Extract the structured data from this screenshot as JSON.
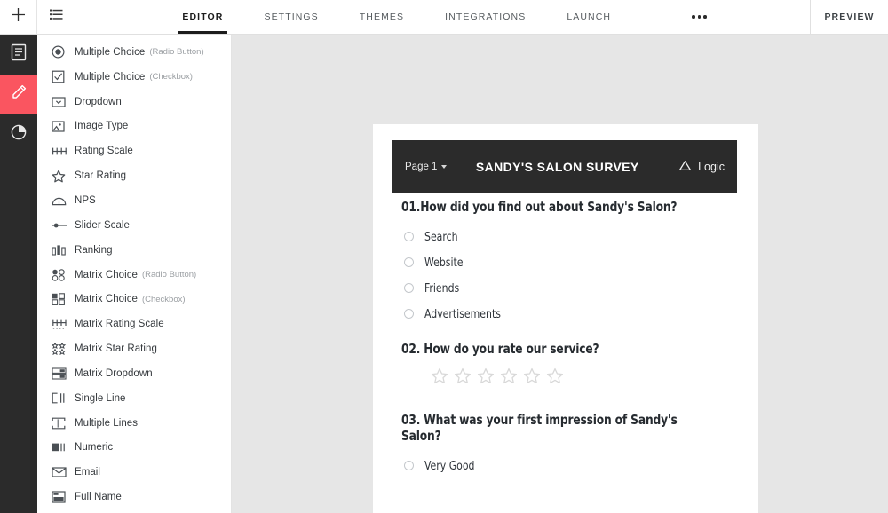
{
  "topbar": {
    "add_icon": "plus-icon",
    "list_icon": "bulleted-list-icon",
    "tabs": [
      {
        "label": "EDITOR",
        "active": true
      },
      {
        "label": "SETTINGS",
        "active": false
      },
      {
        "label": "THEMES",
        "active": false
      },
      {
        "label": "INTEGRATIONS",
        "active": false
      },
      {
        "label": "LAUNCH",
        "active": false
      }
    ],
    "more_icon": "ellipsis-icon",
    "preview_label": "PREVIEW"
  },
  "rail": {
    "items": [
      {
        "name": "pages-icon",
        "active": false
      },
      {
        "name": "edit-pencil-icon",
        "active": true
      },
      {
        "name": "analytics-pie-icon",
        "active": false
      }
    ],
    "active_color": "#fa5560",
    "background": "#2b2b2b"
  },
  "sidebar": {
    "items": [
      {
        "label": "Multiple Choice",
        "sub": "(Radio Button)",
        "icon": "radio-button-icon"
      },
      {
        "label": "Multiple Choice",
        "sub": "(Checkbox)",
        "icon": "checkbox-icon"
      },
      {
        "label": "Dropdown",
        "sub": "",
        "icon": "dropdown-icon"
      },
      {
        "label": "Image Type",
        "sub": "",
        "icon": "image-icon"
      },
      {
        "label": "Rating Scale",
        "sub": "",
        "icon": "rating-scale-icon"
      },
      {
        "label": "Star Rating",
        "sub": "",
        "icon": "star-icon"
      },
      {
        "label": "NPS",
        "sub": "",
        "icon": "gauge-icon"
      },
      {
        "label": "Slider Scale",
        "sub": "",
        "icon": "slider-icon"
      },
      {
        "label": "Ranking",
        "sub": "",
        "icon": "ranking-bars-icon"
      },
      {
        "label": "Matrix Choice",
        "sub": "(Radio Button)",
        "icon": "matrix-radio-icon"
      },
      {
        "label": "Matrix Choice",
        "sub": "(Checkbox)",
        "icon": "matrix-checkbox-icon"
      },
      {
        "label": "Matrix Rating Scale",
        "sub": "",
        "icon": "matrix-rating-icon"
      },
      {
        "label": "Matrix Star Rating",
        "sub": "",
        "icon": "matrix-star-icon"
      },
      {
        "label": "Matrix Dropdown",
        "sub": "",
        "icon": "matrix-dropdown-icon"
      },
      {
        "label": "Single Line",
        "sub": "",
        "icon": "single-line-icon"
      },
      {
        "label": "Multiple Lines",
        "sub": "",
        "icon": "multiple-lines-icon"
      },
      {
        "label": "Numeric",
        "sub": "",
        "icon": "numeric-icon"
      },
      {
        "label": "Email",
        "sub": "",
        "icon": "email-icon"
      },
      {
        "label": "Full Name",
        "sub": "",
        "icon": "full-name-icon"
      }
    ]
  },
  "survey": {
    "page_selector": "Page 1",
    "title": "SANDY'S SALON SURVEY",
    "logic_label": "Logic",
    "logic_icon": "logic-triangle-icon",
    "header_bg": "#2b2b2b",
    "questions": [
      {
        "title": "01.How did you find out about Sandy's Salon?",
        "type": "radio",
        "options": [
          "Search",
          "Website",
          "Friends",
          "Advertisements"
        ]
      },
      {
        "title": "02. How do you rate our service?",
        "type": "star",
        "star_count": 6,
        "stars_filled": 0
      },
      {
        "title": "03. What was your first impression of Sandy's Salon?",
        "type": "radio",
        "options": [
          "Very Good"
        ]
      }
    ]
  }
}
